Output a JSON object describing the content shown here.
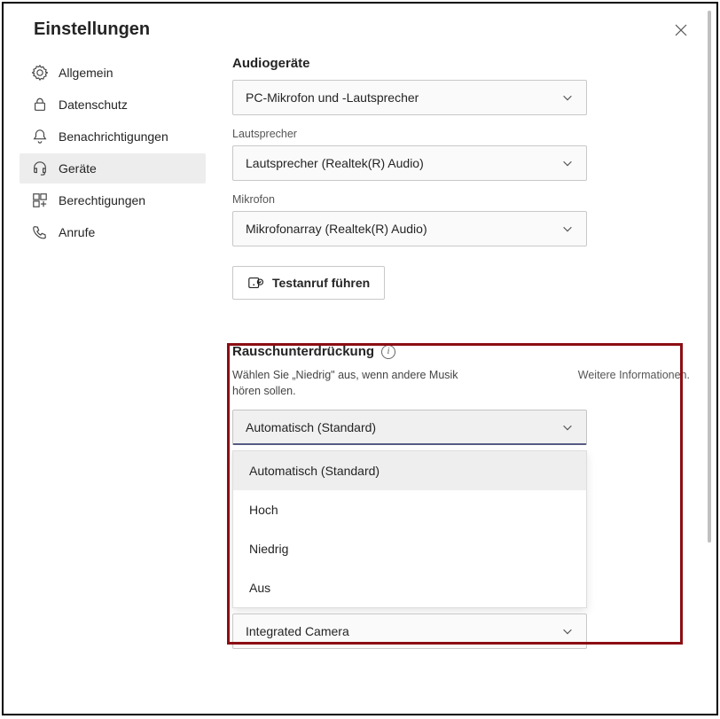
{
  "header": {
    "title": "Einstellungen"
  },
  "sidebar": {
    "items": [
      {
        "label": "Allgemein"
      },
      {
        "label": "Datenschutz"
      },
      {
        "label": "Benachrichtigungen"
      },
      {
        "label": "Geräte"
      },
      {
        "label": "Berechtigungen"
      },
      {
        "label": "Anrufe"
      }
    ]
  },
  "main": {
    "audio_devices_title": "Audiogeräte",
    "audio_device_select": "PC-Mikrofon und -Lautsprecher",
    "speaker_label": "Lautsprecher",
    "speaker_select": "Lautsprecher (Realtek(R) Audio)",
    "mic_label": "Mikrofon",
    "mic_select": "Mikrofonarray (Realtek(R) Audio)",
    "test_call_btn": "Testanruf führen",
    "noise": {
      "title": "Rauschunterdrückung",
      "desc": "Wählen Sie „Niedrig\" aus, wenn andere Musik hören sollen.",
      "more_info": "Weitere Informationen.",
      "selected": "Automatisch (Standard)",
      "options": [
        "Automatisch (Standard)",
        "Hoch",
        "Niedrig",
        "Aus"
      ]
    },
    "camera_select": "Integrated Camera"
  }
}
